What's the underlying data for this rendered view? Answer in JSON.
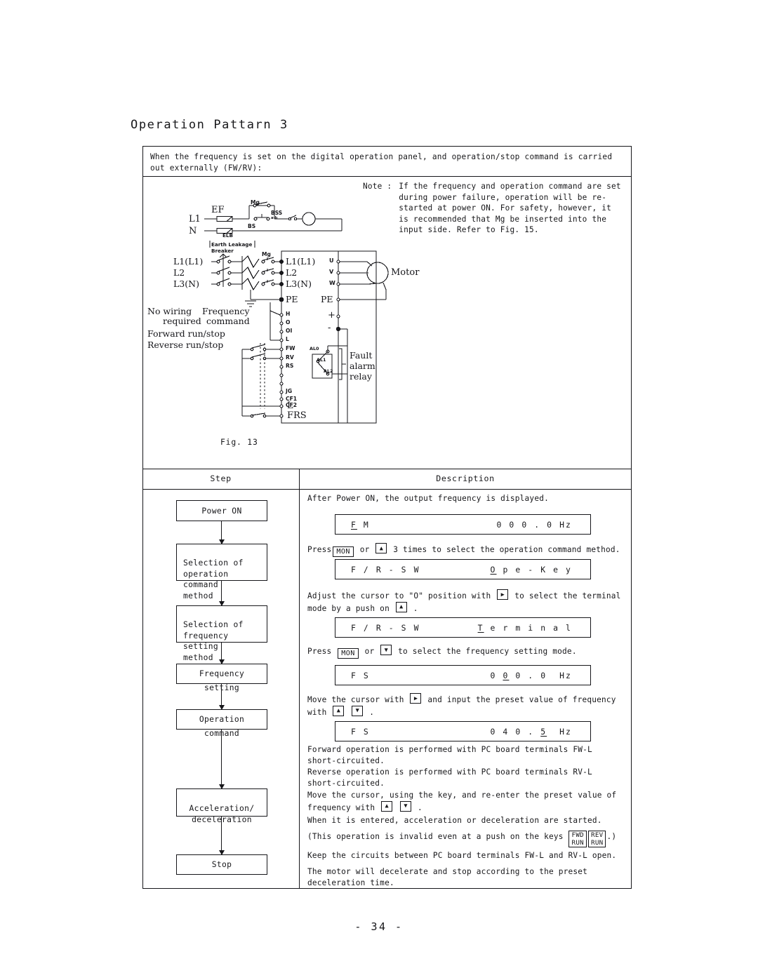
{
  "page": {
    "title": "Operation Pattarn 3",
    "number": "- 34 -"
  },
  "intro": {
    "text": "When the frequency is set on the digital operation panel, and operation/stop command is carried out externally (FW/RV):"
  },
  "note": {
    "label": "Note :",
    "lines": [
      "If the frequency and operation command are set",
      "during power failure, operation will be re-",
      "started at power ON.  For safety, however, it",
      "is recommended that Mg be inserted into the",
      "input side.  Refer to Fig. 15."
    ]
  },
  "figure": {
    "caption": "Fig. 13",
    "power_line": {
      "l1": "L1",
      "n": "N",
      "ef": "EF",
      "mg_top": "Mg",
      "bs": "BS",
      "bss": "BSS",
      "bss_sub": "a-b",
      "mg_coil": "Mg",
      "elb": "ELB",
      "elb_note_1": "Earth Leakage",
      "elb_note_2": "Breaker"
    },
    "input_terminals": [
      "L1(L1)",
      "L2",
      "L3(N)"
    ],
    "inverter_terminals_left": [
      "L1(L1)",
      "L2",
      "L3(N)",
      "PE"
    ],
    "inverter_terminals_control": [
      "H",
      "O",
      "OI",
      "L",
      "FW",
      "RV",
      "RS",
      "JG",
      "CF1",
      "CF2",
      "L",
      "FRS"
    ],
    "inverter_terminals_right": [
      "U",
      "V",
      "W",
      "PE",
      "+",
      "-"
    ],
    "mg_contactor": "Mg",
    "motor": "Motor",
    "alarm_terminals": [
      "AL0",
      "AL1",
      "AL2"
    ],
    "alarm_label_lines": [
      "Fault",
      "alarm",
      "relay"
    ],
    "left_labels": {
      "no_wiring_1": "No wiring",
      "no_wiring_2": "required",
      "frequency_1": "Frequency",
      "frequency_2": "command",
      "forward": "Forward run/stop",
      "reverse": "Reverse run/stop"
    }
  },
  "table": {
    "headers": {
      "step": "Step",
      "description": "Description"
    },
    "steps": [
      {
        "id": "power-on",
        "label": "Power ON"
      },
      {
        "id": "selection-operation",
        "label": "Selection of\noperation command\nmethod"
      },
      {
        "id": "selection-frequency",
        "label": "Selection of\nfrequency setting\nmethod"
      },
      {
        "id": "frequency-setting",
        "label": "Frequency setting"
      },
      {
        "id": "operation-command",
        "label": "Operation command"
      },
      {
        "id": "acceleration",
        "label": "Acceleration/\ndeceleration"
      },
      {
        "id": "stop",
        "label": "Stop"
      }
    ],
    "descriptions": {
      "d1": "After Power ON, the output frequency is displayed.",
      "d2_a": "Press",
      "d2_key": "MON",
      "d2_b": "or",
      "d2_c": "3 times to select the operation command method.",
      "d3_a": "Adjust the cursor to \"O\" position with",
      "d3_b": "to select the terminal",
      "d3_c": "mode by a push on",
      "d3_d": ".",
      "d4_a": "Press",
      "d4_key": "MON",
      "d4_b": "or",
      "d4_c": "to select the frequency setting mode.",
      "d5_a": "Move the cursor with",
      "d5_b": "and input the preset value of frequency",
      "d5_c": "with",
      "d5_d": ".",
      "d6": "Forward operation is performed with PC board terminals FW-L\nshort-circuited.",
      "d7": "Reverse operation is performed with PC board terminals RV-L\nshort-circuited.",
      "d8_a": "Move the cursor, using the key, and re-enter the preset value of",
      "d8_b": "frequency with",
      "d8_c": ".",
      "d9": "When it is entered, acceleration or deceleration are started.",
      "d10_a": "(This operation is invalid even at a push on the keys",
      "d10_key1_l1": "FWD",
      "d10_key1_l2": "RUN",
      "d10_key2_l1": "REV",
      "d10_key2_l2": "RUN",
      "d10_b": ".)",
      "d11": "Keep the circuits between PC board terminals FW-L and RV-L open.",
      "d12": "The motor will decelerate and stop according to the preset\ndeceleration time."
    },
    "displays": [
      {
        "id": "lcd-fm",
        "left": "F M",
        "left_underline": "F",
        "right": "0 0 0 . 0  Hz",
        "right_underline": ""
      },
      {
        "id": "lcd-frsw-ope",
        "left": "F / R - S W",
        "left_underline": "",
        "right": "O p e - K e y",
        "right_underline": "O"
      },
      {
        "id": "lcd-frsw-term",
        "left": "F / R - S W",
        "left_underline": "",
        "right": "T e r m i n a l",
        "right_underline": "T"
      },
      {
        "id": "lcd-fs-000",
        "left": "F S",
        "left_underline": "",
        "right": "0 0 0 . 0  Hz",
        "right_underline": "2nd-0"
      },
      {
        "id": "lcd-fs-040",
        "left": "F S",
        "left_underline": "",
        "right": "0 4 0 . 5  Hz",
        "right_underline": "5"
      }
    ]
  },
  "icons": {
    "arrow_up": "▲",
    "arrow_down": "▼",
    "arrow_right": "▶"
  },
  "colors": {
    "ink": "#16161a",
    "paper": "#ffffff"
  }
}
